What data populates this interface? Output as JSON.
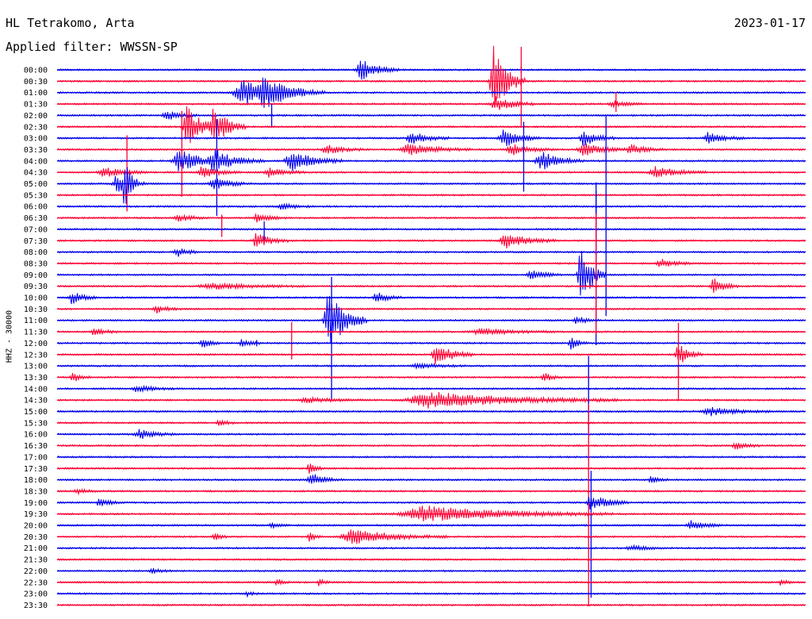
{
  "header": {
    "station": "HL Tetrakomo, Arta",
    "date": "2023-01-17",
    "filter": "Applied filter: WWSSN-SP"
  },
  "colors": {
    "blue": "#0000ee",
    "red": "#ff0033"
  },
  "chart_data": {
    "type": "line",
    "title": "HL Tetrakomo, Arta",
    "subtitle": "Applied filter: WWSSN-SP",
    "ylabel": "HHZ - 30000",
    "line_colors_alternate": [
      "blue",
      "red"
    ],
    "rows": [
      "00:00",
      "00:30",
      "01:00",
      "01:30",
      "02:00",
      "02:30",
      "03:00",
      "03:30",
      "04:00",
      "04:30",
      "05:00",
      "05:30",
      "06:00",
      "06:30",
      "07:00",
      "07:30",
      "08:00",
      "08:30",
      "09:00",
      "09:30",
      "10:00",
      "10:30",
      "11:00",
      "11:30",
      "12:00",
      "12:30",
      "13:00",
      "13:30",
      "14:00",
      "14:30",
      "15:00",
      "15:30",
      "16:00",
      "16:30",
      "17:00",
      "17:30",
      "18:00",
      "18:30",
      "19:00",
      "19:30",
      "20:00",
      "20:30",
      "21:00",
      "21:30",
      "22:00",
      "22:30",
      "23:00",
      "23:30"
    ],
    "x_unit": "minutes",
    "x_range": [
      0,
      30
    ],
    "events": [
      {
        "row": 0,
        "x": 12.2,
        "amp": 14,
        "dur": 0.6
      },
      {
        "row": 1,
        "x": 17.5,
        "amp": 45,
        "dur": 0.5
      },
      {
        "row": 2,
        "x": 7.5,
        "amp": 16,
        "dur": 1.3
      },
      {
        "row": 2,
        "x": 8.3,
        "amp": 12,
        "dur": 0.8
      },
      {
        "row": 3,
        "x": 17.6,
        "amp": 10,
        "dur": 0.6
      },
      {
        "row": 3,
        "x": 22.3,
        "amp": 4,
        "dur": 0.5
      },
      {
        "row": 4,
        "x": 4.4,
        "amp": 6,
        "dur": 0.5
      },
      {
        "row": 5,
        "x": 5.2,
        "amp": 28,
        "dur": 0.5
      },
      {
        "row": 5,
        "x": 6.3,
        "amp": 25,
        "dur": 0.5
      },
      {
        "row": 6,
        "x": 14.2,
        "amp": 8,
        "dur": 0.6
      },
      {
        "row": 6,
        "x": 17.9,
        "amp": 12,
        "dur": 0.6
      },
      {
        "row": 6,
        "x": 21.1,
        "amp": 10,
        "dur": 0.5
      },
      {
        "row": 6,
        "x": 26.1,
        "amp": 7,
        "dur": 0.6
      },
      {
        "row": 7,
        "x": 10.8,
        "amp": 6,
        "dur": 0.6
      },
      {
        "row": 7,
        "x": 14.1,
        "amp": 7,
        "dur": 1.0
      },
      {
        "row": 7,
        "x": 18.2,
        "amp": 7,
        "dur": 0.7
      },
      {
        "row": 7,
        "x": 21.1,
        "amp": 8,
        "dur": 0.7
      },
      {
        "row": 7,
        "x": 23.0,
        "amp": 6,
        "dur": 0.6
      },
      {
        "row": 8,
        "x": 4.9,
        "amp": 14,
        "dur": 0.8
      },
      {
        "row": 8,
        "x": 6.3,
        "amp": 13,
        "dur": 0.8
      },
      {
        "row": 8,
        "x": 9.4,
        "amp": 13,
        "dur": 0.8
      },
      {
        "row": 8,
        "x": 19.4,
        "amp": 12,
        "dur": 0.7
      },
      {
        "row": 9,
        "x": 1.9,
        "amp": 6,
        "dur": 0.7
      },
      {
        "row": 9,
        "x": 5.8,
        "amp": 7,
        "dur": 0.6
      },
      {
        "row": 9,
        "x": 8.5,
        "amp": 6,
        "dur": 0.6
      },
      {
        "row": 9,
        "x": 24.0,
        "amp": 7,
        "dur": 0.8
      },
      {
        "row": 10,
        "x": 2.4,
        "amp": 12,
        "dur": 0.5
      },
      {
        "row": 10,
        "x": 2.7,
        "amp": 32,
        "dur": 0.2
      },
      {
        "row": 10,
        "x": 6.3,
        "amp": 7,
        "dur": 0.6
      },
      {
        "row": 12,
        "x": 9.0,
        "amp": 4,
        "dur": 0.5
      },
      {
        "row": 13,
        "x": 4.8,
        "amp": 5,
        "dur": 0.5
      },
      {
        "row": 13,
        "x": 8.0,
        "amp": 5,
        "dur": 0.5
      },
      {
        "row": 15,
        "x": 8.0,
        "amp": 10,
        "dur": 0.5
      },
      {
        "row": 15,
        "x": 18.0,
        "amp": 9,
        "dur": 0.8
      },
      {
        "row": 16,
        "x": 4.8,
        "amp": 6,
        "dur": 0.4
      },
      {
        "row": 17,
        "x": 24.2,
        "amp": 6,
        "dur": 0.5
      },
      {
        "row": 18,
        "x": 21.0,
        "amp": 40,
        "dur": 0.4
      },
      {
        "row": 18,
        "x": 19.0,
        "amp": 6,
        "dur": 0.5
      },
      {
        "row": 19,
        "x": 26.3,
        "amp": 10,
        "dur": 0.4
      },
      {
        "row": 19,
        "x": 6.2,
        "amp": 4,
        "dur": 1.5
      },
      {
        "row": 20,
        "x": 0.6,
        "amp": 8,
        "dur": 0.4
      },
      {
        "row": 20,
        "x": 12.8,
        "amp": 7,
        "dur": 0.4
      },
      {
        "row": 21,
        "x": 4.0,
        "amp": 5,
        "dur": 0.4
      },
      {
        "row": 22,
        "x": 10.9,
        "amp": 40,
        "dur": 0.6
      },
      {
        "row": 22,
        "x": 20.8,
        "amp": 5,
        "dur": 0.4
      },
      {
        "row": 23,
        "x": 1.5,
        "amp": 5,
        "dur": 0.4
      },
      {
        "row": 23,
        "x": 17.0,
        "amp": 4,
        "dur": 1.2
      },
      {
        "row": 24,
        "x": 5.8,
        "amp": 7,
        "dur": 0.3
      },
      {
        "row": 24,
        "x": 7.4,
        "amp": 5,
        "dur": 0.3
      },
      {
        "row": 24,
        "x": 20.6,
        "amp": 8,
        "dur": 0.3
      },
      {
        "row": 25,
        "x": 15.2,
        "amp": 14,
        "dur": 0.6
      },
      {
        "row": 25,
        "x": 24.9,
        "amp": 14,
        "dur": 0.4
      },
      {
        "row": 26,
        "x": 14.5,
        "amp": 3,
        "dur": 0.8
      },
      {
        "row": 27,
        "x": 0.6,
        "amp": 8,
        "dur": 0.3
      },
      {
        "row": 27,
        "x": 19.5,
        "amp": 6,
        "dur": 0.3
      },
      {
        "row": 28,
        "x": 3.2,
        "amp": 4,
        "dur": 0.6
      },
      {
        "row": 29,
        "x": 15.0,
        "amp": 10,
        "dur": 3.0
      },
      {
        "row": 29,
        "x": 10.0,
        "amp": 3,
        "dur": 1.0
      },
      {
        "row": 30,
        "x": 26.2,
        "amp": 5,
        "dur": 1.0
      },
      {
        "row": 31,
        "x": 6.5,
        "amp": 4,
        "dur": 0.3
      },
      {
        "row": 32,
        "x": 3.3,
        "amp": 6,
        "dur": 0.6
      },
      {
        "row": 33,
        "x": 27.2,
        "amp": 5,
        "dur": 0.4
      },
      {
        "row": 35,
        "x": 10.1,
        "amp": 10,
        "dur": 0.2
      },
      {
        "row": 36,
        "x": 10.2,
        "amp": 8,
        "dur": 0.5
      },
      {
        "row": 36,
        "x": 23.8,
        "amp": 4,
        "dur": 0.3
      },
      {
        "row": 37,
        "x": 0.8,
        "amp": 4,
        "dur": 0.3
      },
      {
        "row": 38,
        "x": 1.7,
        "amp": 5,
        "dur": 0.4
      },
      {
        "row": 38,
        "x": 21.4,
        "amp": 10,
        "dur": 0.6
      },
      {
        "row": 39,
        "x": 14.8,
        "amp": 10,
        "dur": 3.0
      },
      {
        "row": 40,
        "x": 8.6,
        "amp": 3,
        "dur": 0.3
      },
      {
        "row": 40,
        "x": 25.4,
        "amp": 6,
        "dur": 0.5
      },
      {
        "row": 41,
        "x": 11.9,
        "amp": 9,
        "dur": 1.5
      },
      {
        "row": 41,
        "x": 6.3,
        "amp": 6,
        "dur": 0.2
      },
      {
        "row": 41,
        "x": 10.1,
        "amp": 6,
        "dur": 0.2
      },
      {
        "row": 42,
        "x": 23.0,
        "amp": 3,
        "dur": 0.6
      },
      {
        "row": 44,
        "x": 3.8,
        "amp": 3,
        "dur": 0.4
      },
      {
        "row": 45,
        "x": 8.8,
        "amp": 5,
        "dur": 0.2
      },
      {
        "row": 45,
        "x": 10.5,
        "amp": 4,
        "dur": 0.2
      },
      {
        "row": 45,
        "x": 29.0,
        "amp": 4,
        "dur": 0.2
      },
      {
        "row": 46,
        "x": 7.6,
        "amp": 3,
        "dur": 0.2
      }
    ],
    "spikes": [
      {
        "row": 0,
        "x": 18.6,
        "up": 4,
        "down": 4
      },
      {
        "row": 3,
        "x": 18.6,
        "up": 72,
        "down": 28
      },
      {
        "row": 5,
        "x": 5.0,
        "up": 20,
        "down": 88
      },
      {
        "row": 6,
        "x": 6.4,
        "up": 24,
        "down": 98
      },
      {
        "row": 7,
        "x": 2.8,
        "up": 18,
        "down": 78
      },
      {
        "row": 10,
        "x": 18.7,
        "up": 78,
        "down": 10
      },
      {
        "row": 13,
        "x": 6.6,
        "up": 4,
        "down": 24
      },
      {
        "row": 14,
        "x": 8.3,
        "up": 10,
        "down": 15
      },
      {
        "row": 16,
        "x": 21.6,
        "up": 88,
        "down": 22
      },
      {
        "row": 18,
        "x": 22.0,
        "up": 200,
        "down": 52
      },
      {
        "row": 20,
        "x": 21.6,
        "up": 135,
        "down": 60
      },
      {
        "row": 21,
        "x": 21.6,
        "up": 120,
        "down": 32
      },
      {
        "row": 22,
        "x": 11.0,
        "up": 55,
        "down": 100
      },
      {
        "row": 23,
        "x": 9.4,
        "up": 12,
        "down": 35
      },
      {
        "row": 25,
        "x": 24.9,
        "up": 40,
        "down": 28
      },
      {
        "row": 27,
        "x": 24.9,
        "up": 10,
        "down": 28
      },
      {
        "row": 30,
        "x": 21.3,
        "up": 70,
        "down": 30
      },
      {
        "row": 37,
        "x": 21.3,
        "up": 110,
        "down": 16
      },
      {
        "row": 38,
        "x": 21.4,
        "up": 40,
        "down": 120
      },
      {
        "row": 45,
        "x": 21.3,
        "up": 100,
        "down": 30
      },
      {
        "row": 4,
        "x": 8.6,
        "up": 15,
        "down": 15
      },
      {
        "row": 3,
        "x": 22.4,
        "up": 15,
        "down": 10
      },
      {
        "row": 24,
        "x": 8.0,
        "up": 4,
        "down": 4
      }
    ]
  }
}
